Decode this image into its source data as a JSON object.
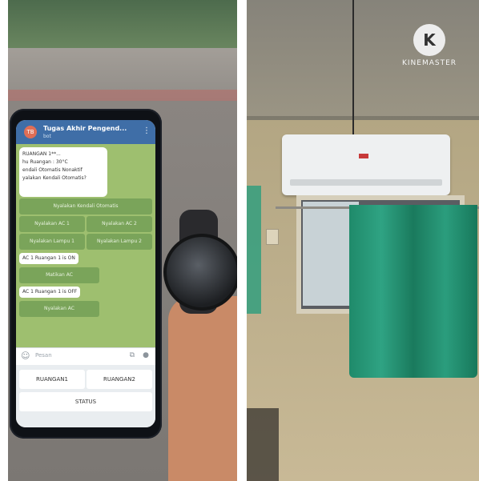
{
  "phone_screen": {
    "chat_title": "Tugas Akhir Pengend...",
    "chat_subtitle": "bot",
    "avatar_text": "TB",
    "message_lines": [
      "RUANGAN 1**...",
      "hu Ruangan : 30°C",
      "endali Otomatis Nonaktif",
      "yalakan Kendali Otomatis?"
    ],
    "buttons": {
      "auto_on": "Nyalakan Kendali Otomatis",
      "ac1_on": "Nyalakan AC 1",
      "ac2_on": "Nyalakan AC 2",
      "lamp1_on": "Nyalakan Lampu 1",
      "lamp2_on": "Nyalakan Lampu 2",
      "turn_off": "Matikan AC",
      "turn_on": "Nyalakan AC"
    },
    "status_messages": [
      "AC 1 Ruangan 1 is ON",
      "AC 1 Ruangan 1 is OFF"
    ],
    "input_placeholder": "Pesan",
    "keyboard_buttons": {
      "room1": "RUANGAN1",
      "room2": "RUANGAN2",
      "status": "STATUS"
    }
  },
  "watermark": {
    "text": "KINEMASTER",
    "logo_letter": "K"
  },
  "colors": {
    "telegram_blue": "#3f6ea7",
    "chat_green": "#9ebf6f",
    "curtain_green": "#2fa383"
  }
}
